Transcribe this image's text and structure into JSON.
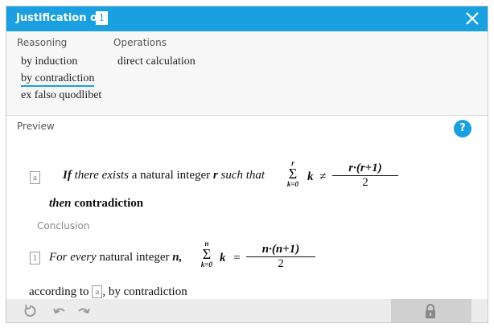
{
  "dialog": {
    "title": "Justification of",
    "title_ref": "1"
  },
  "options": {
    "reasoning_header": "Reasoning",
    "operations_header": "Operations",
    "reasoning": [
      {
        "label": "by induction",
        "selected": false
      },
      {
        "label": "by contradiction",
        "selected": true
      },
      {
        "label": "ex falso quodlibet",
        "selected": false
      }
    ],
    "operations": [
      {
        "label": "direct calculation"
      }
    ]
  },
  "preview": {
    "label": "Preview",
    "help": "?",
    "assumption": {
      "ref": "a",
      "if": "If",
      "there_exists": "there exists",
      "text1": "a natural integer",
      "var": "r",
      "such_that": "such that",
      "sum_top": "r",
      "sum_bottom": "k=0",
      "sum_symbol": "Σ",
      "sum_var": "k",
      "relation": "≠",
      "frac_num": "r·(r+1)",
      "frac_den": "2"
    },
    "then_line": {
      "then": "then",
      "word": "contradiction"
    },
    "conclusion_label": "Conclusion",
    "conclusion": {
      "ref": "1",
      "for_every": "For every",
      "text1": "natural integer",
      "var": "n,",
      "sum_top": "n",
      "sum_bottom": "k=0",
      "sum_symbol": "Σ",
      "sum_var": "k",
      "relation": "=",
      "frac_num": "n·(n+1)",
      "frac_den": "2"
    },
    "according": {
      "prefix": "according to",
      "ref": "a",
      "suffix": ", by contradiction"
    }
  },
  "toolbar": {
    "icons": [
      "reset-icon",
      "undo-icon",
      "redo-icon",
      "lock-icon"
    ]
  },
  "colors": {
    "accent": "#1aa0e0"
  }
}
